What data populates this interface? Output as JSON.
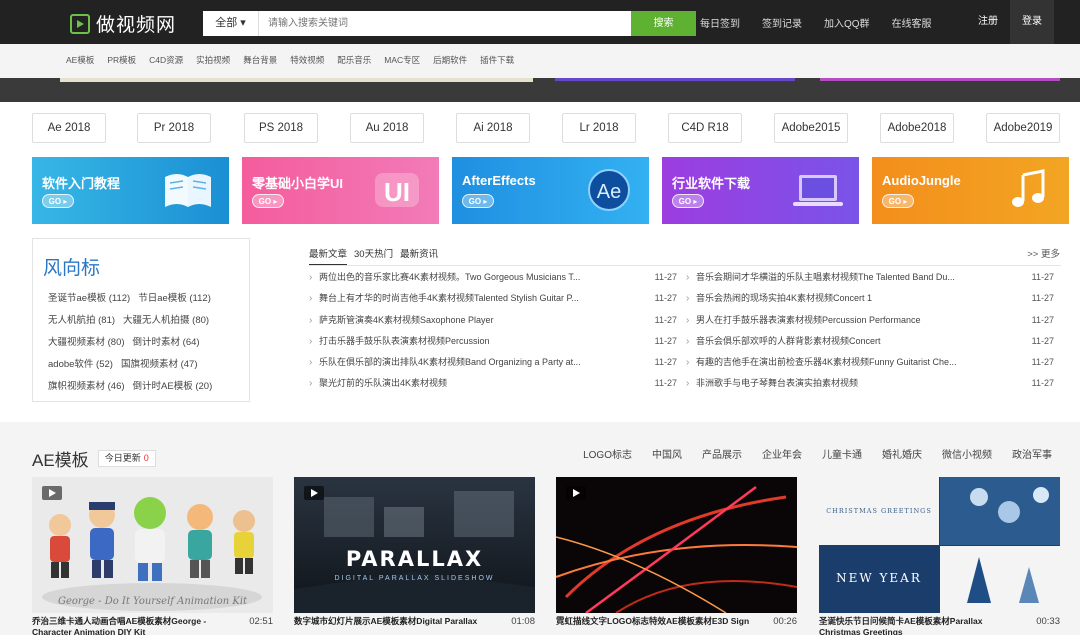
{
  "header": {
    "logo_text": "做视频网",
    "search_category": "全部 ▾",
    "search_placeholder": "请输入搜索关键词",
    "search_button": "搜索",
    "links": [
      "每日签到",
      "签到记录",
      "加入QQ群",
      "在线客服"
    ],
    "register": "注册",
    "login": "登录"
  },
  "subnav": [
    "AE模板",
    "PR模板",
    "C4D资源",
    "实拍视频",
    "舞台背景",
    "特效视频",
    "配乐音乐",
    "MAC专区",
    "后期软件",
    "插件下载"
  ],
  "software_tabs": [
    "Ae 2018",
    "Pr 2018",
    "PS 2018",
    "Au 2018",
    "Ai 2018",
    "Lr 2018",
    "C4D R18",
    "Adobe2015",
    "Adobe2018",
    "Adobe2019"
  ],
  "promos": [
    {
      "title": "软件入门教程",
      "go": "GO ▸",
      "icon": "book-icon"
    },
    {
      "title": "零基础小白学UI",
      "go": "GO ▸",
      "icon": "ui-logo-icon"
    },
    {
      "title": "AfterEffects",
      "go": "GO ▸",
      "icon": "ae-logo-icon"
    },
    {
      "title": "行业软件下载",
      "go": "GO ▸",
      "icon": "laptop-icon"
    },
    {
      "title": "AudioJungle",
      "go": "GO ▸",
      "icon": "music-note-icon"
    }
  ],
  "tags": {
    "title": "风向标",
    "rows": [
      [
        "圣诞节ae模板 (112)",
        "节日ae模板 (112)"
      ],
      [
        "无人机航拍 (81)",
        "大疆无人机拍摄 (80)"
      ],
      [
        "大疆视频素材 (80)",
        "倒计时素材 (64)"
      ],
      [
        "adobe软件 (52)",
        "国旗视频素材 (47)"
      ],
      [
        "旗帜视频素材 (46)",
        "倒计时AE模板 (20)"
      ]
    ]
  },
  "news": {
    "tabs": [
      "最新文章",
      "30天热门",
      "最新资讯"
    ],
    "more": ">> 更多",
    "left": [
      {
        "title": "两位出色的音乐家比赛4K素材视频。Two Gorgeous Musicians T...",
        "date": "11-27"
      },
      {
        "title": "舞台上有才华的时尚吉他手4K素材视频Talented Stylish Guitar P...",
        "date": "11-27"
      },
      {
        "title": "萨克斯管演奏4K素材视频Saxophone Player",
        "date": "11-27"
      },
      {
        "title": "打击乐器手鼓乐队表演素材视频Percussion",
        "date": "11-27"
      },
      {
        "title": "乐队在俱乐部的演出排队4K素材视频Band Organizing a Party at...",
        "date": "11-27"
      },
      {
        "title": "聚光灯前的乐队演出4K素材视频",
        "date": "11-27"
      }
    ],
    "right": [
      {
        "title": "音乐会期间才华横溢的乐队主唱素材视频The Talented Band Du...",
        "date": "11-27"
      },
      {
        "title": "音乐会热闹的现场实拍4K素材视频Concert 1",
        "date": "11-27"
      },
      {
        "title": "男人在打手鼓乐器表演素材视频Percussion Performance",
        "date": "11-27"
      },
      {
        "title": "音乐会俱乐部欢呼的人群背影素材视频Concert",
        "date": "11-27"
      },
      {
        "title": "有趣的吉他手在演出前检查乐器4K素材视频Funny Guitarist Che...",
        "date": "11-27"
      },
      {
        "title": "非洲歌手与电子琴舞台表演实拍素材视频",
        "date": "11-27"
      }
    ]
  },
  "ae_section": {
    "title": "AE模板",
    "today_label": "今日更新",
    "today_count": "0",
    "categories": [
      "LOGO标志",
      "中国风",
      "产品展示",
      "企业年会",
      "儿童卡通",
      "婚礼婚庆",
      "微信小视频",
      "政治军事"
    ],
    "cards": [
      {
        "title": "乔治三维卡通人动画合唱AE模板素材George - Character Animation DIY Kit",
        "duration": "02:51",
        "caption": "George - Do It Yourself Animation Kit"
      },
      {
        "title": "数字城市幻灯片展示AE模板素材Digital Parallax",
        "duration": "01:08",
        "caption": "DIGITAL PARALLAX SLIDESHOW",
        "caption_big": "PARALLAX"
      },
      {
        "title": "霓虹描线文字LOGO标志特效AE模板素材E3D Sign",
        "duration": "00:26"
      },
      {
        "title": "圣诞快乐节日问候简卡AE模板素材Parallax Christmas Greetings",
        "duration": "00:33",
        "caption": "CHRISTMAS GREETINGS",
        "caption_big": "NEW YEAR"
      }
    ]
  },
  "colors": {
    "accent": "#5fb131",
    "header_bg": "#222222",
    "tag_title": "#2a78c5",
    "badge_count": "#ee3333"
  }
}
